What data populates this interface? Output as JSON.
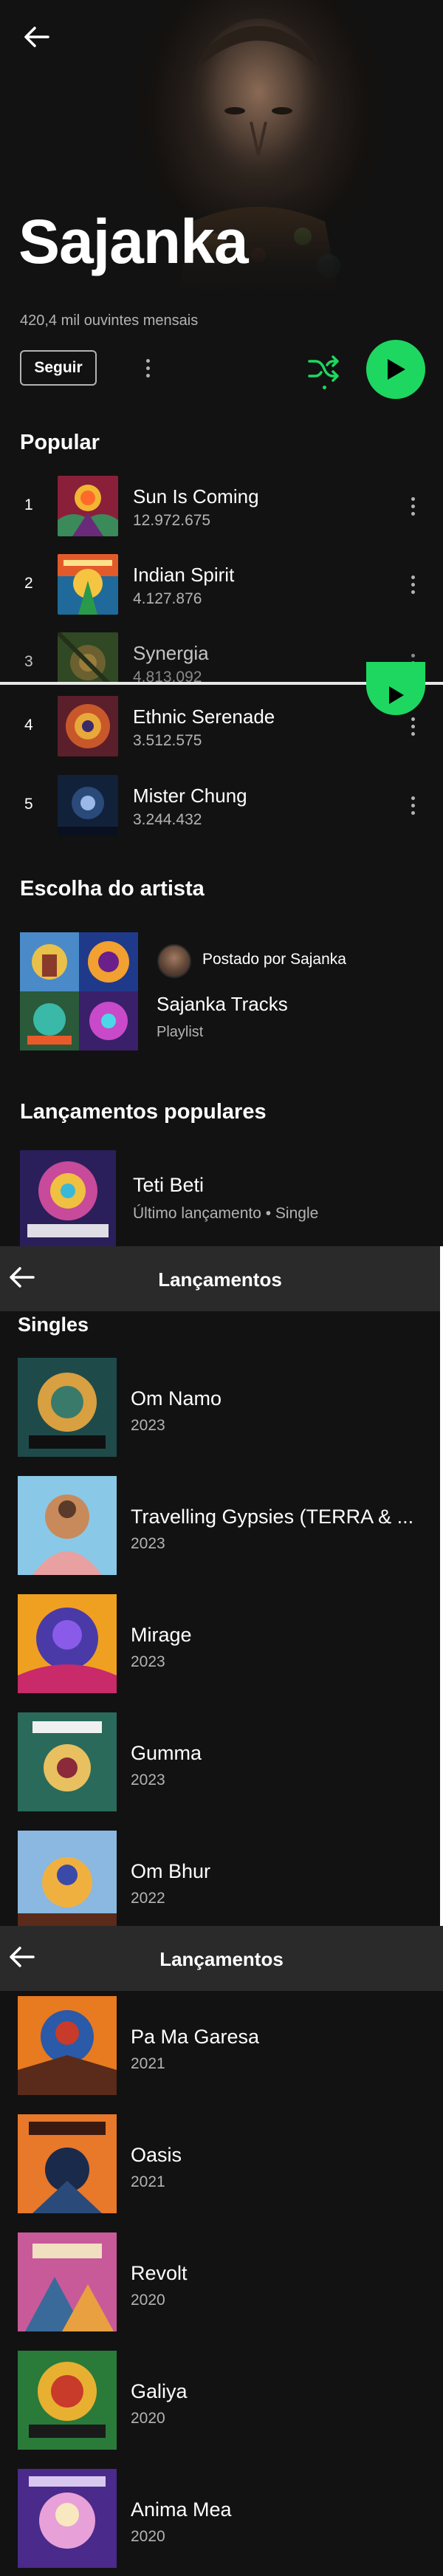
{
  "artist": {
    "name": "Sajanka",
    "monthly_listeners": "420,4 mil ouvintes mensais",
    "follow_label": "Seguir"
  },
  "popular": {
    "title": "Popular",
    "tracks": [
      {
        "rank": "1",
        "name": "Sun Is Coming",
        "plays": "12.972.675"
      },
      {
        "rank": "2",
        "name": "Indian Spirit",
        "plays": "4.127.876"
      },
      {
        "rank": "3",
        "name": "Synergia",
        "plays": "4.813.092"
      },
      {
        "rank": "4",
        "name": "Ethnic Serenade",
        "plays": "3.512.575"
      },
      {
        "rank": "5",
        "name": "Mister Chung",
        "plays": "3.244.432"
      }
    ]
  },
  "artist_pick": {
    "title": "Escolha do artista",
    "posted_by": "Postado por Sajanka",
    "playlist_name": "Sajanka Tracks",
    "playlist_type": "Playlist"
  },
  "popular_releases": {
    "title": "Lançamentos populares",
    "items": [
      {
        "name": "Teti Beti",
        "subtitle": "Último lançamento • Single"
      }
    ]
  },
  "releases_screen_1": {
    "header_title": "Lançamentos",
    "section_label": "Singles",
    "items": [
      {
        "name": "Om Namo",
        "year": "2023"
      },
      {
        "name": "Travelling Gypsies (TERRA & ...",
        "year": "2023"
      },
      {
        "name": "Mirage",
        "year": "2023"
      },
      {
        "name": "Gumma",
        "year": "2023"
      },
      {
        "name": "Om Bhur",
        "year": "2022"
      }
    ]
  },
  "releases_screen_2": {
    "header_title": "Lançamentos",
    "items": [
      {
        "name": "Pa Ma Garesa",
        "year": "2021"
      },
      {
        "name": "Oasis",
        "year": "2021"
      },
      {
        "name": "Revolt",
        "year": "2020"
      },
      {
        "name": "Galiya",
        "year": "2020"
      },
      {
        "name": "Anima Mea",
        "year": "2020"
      }
    ]
  },
  "colors": {
    "accent": "#1ed760",
    "background": "#121212",
    "header_bar": "#2a2a2a",
    "secondary_text": "#b3b3b3"
  },
  "icons": {
    "back": "arrow-left-icon",
    "more": "more-vertical-icon",
    "shuffle": "shuffle-icon",
    "play": "play-icon"
  }
}
